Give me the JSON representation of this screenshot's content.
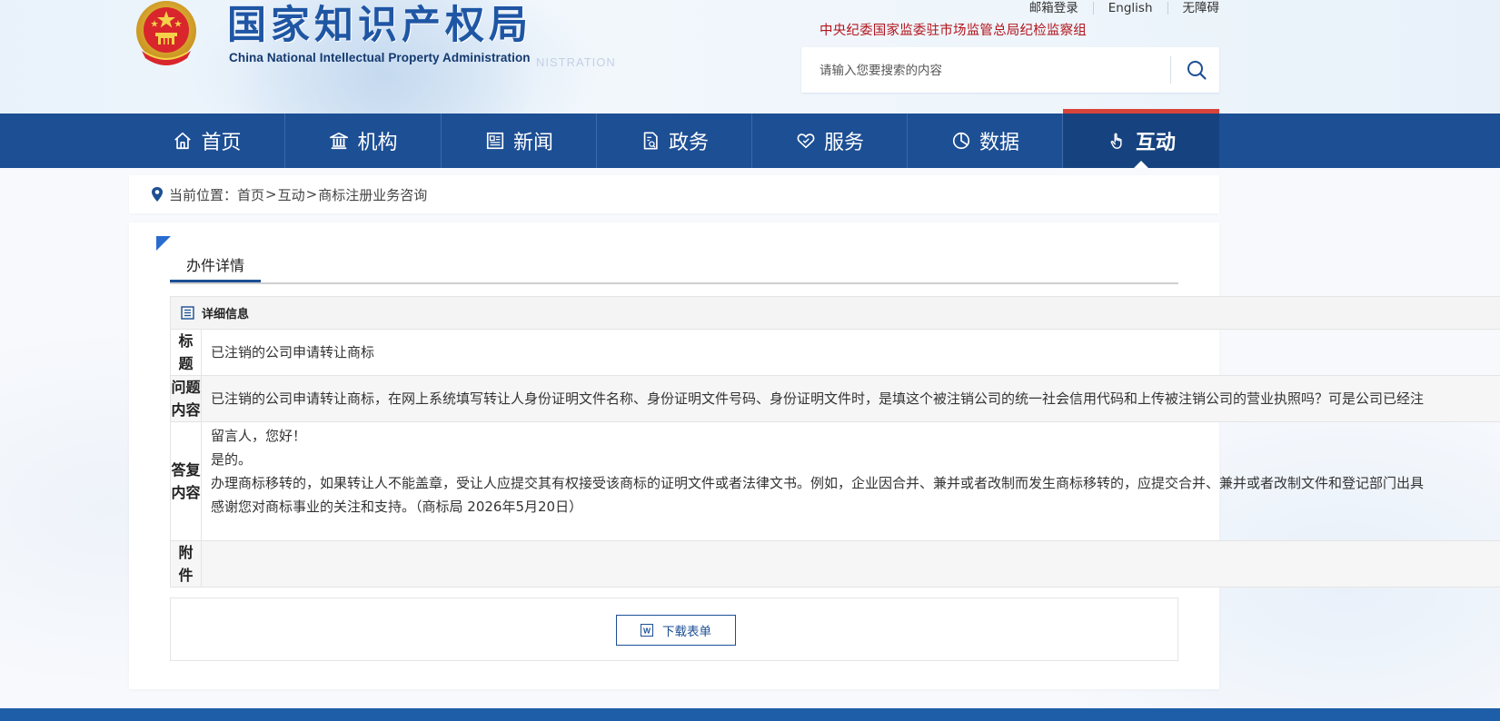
{
  "header": {
    "logo_cn": "国家知识产权局",
    "logo_en": "China National Intellectual Property Administration",
    "logo_ghost": "NISTRATION",
    "top_links": [
      "邮箱登录",
      "English",
      "无障碍"
    ],
    "discipline_link": "中央纪委国家监委驻市场监管总局纪检监察组",
    "search": {
      "placeholder": "请输入您要搜索的内容",
      "icon": "search-icon"
    },
    "emblem": "national-emblem-icon"
  },
  "nav": {
    "items": [
      {
        "label": "首页",
        "icon": "home-icon"
      },
      {
        "label": "机构",
        "icon": "institution-icon"
      },
      {
        "label": "新闻",
        "icon": "newspaper-icon"
      },
      {
        "label": "政务",
        "icon": "document-icon"
      },
      {
        "label": "服务",
        "icon": "heart-hand-icon"
      },
      {
        "label": "数据",
        "icon": "pie-chart-icon"
      },
      {
        "label": "互动",
        "icon": "pointer-hand-icon"
      }
    ],
    "active_index": 6
  },
  "breadcrumb": {
    "prefix": "当前位置：",
    "items": [
      "首页",
      "互动",
      "商标注册业务咨询"
    ],
    "separator": ">"
  },
  "tabs": {
    "active": "办件详情"
  },
  "detail": {
    "heading": "详细信息",
    "title_label": "标题",
    "title_value": "已注销的公司申请转让商标",
    "question_label": "问题内容",
    "question_value": "已注销的公司申请转让商标，在网上系统填写转让人身份证明文件名称、身份证明文件号码、身份证明文件时，是填这个被注销公司的统一社会信用代码和上传被注销公司的营业执照吗？可是公司已经注",
    "answer_label": "答复内容",
    "answer_lines": [
      "留言人，您好！",
      "是的。",
      "办理商标移转的，如果转让人不能盖章，受让人应提交其有权接受该商标的证明文件或者法律文书。例如，企业因合并、兼并或者改制而发生商标移转的，应提交合并、兼并或者改制文件和登记部门出具",
      "感谢您对商标事业的关注和支持。（商标局 2026年5月20日）"
    ],
    "attachment_label": "附件",
    "attachment_value": ""
  },
  "download": {
    "label": "下载表单",
    "icon": "word-doc-icon"
  },
  "colors": {
    "nav_bg": "#1d4f94",
    "nav_active_bg": "#16437f",
    "nav_active_top": "#d9443a",
    "logo": "#1f56a4",
    "discipline": "#b3141c",
    "corner_mark": "#2a6bd0",
    "footer": "#1e5ea8"
  }
}
